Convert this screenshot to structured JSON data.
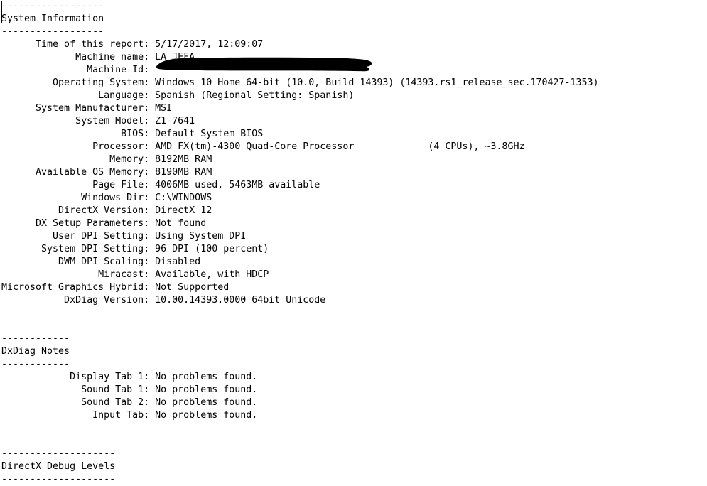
{
  "document": {
    "type": "dxdiag-report",
    "text_color": "#000000",
    "background_color": "#ffffff",
    "caret_visible": true
  },
  "sections": [
    {
      "id": "system-information",
      "rule_top": "------------------",
      "title": "System Information",
      "rule_bottom": "------------------",
      "entries": [
        {
          "label": "Time of this report",
          "value": "5/17/2017, 12:09:07"
        },
        {
          "label": "Machine name",
          "value": "LA_JEFA"
        },
        {
          "label": "Machine Id",
          "value": "",
          "redacted": true
        },
        {
          "label": "Operating System",
          "value": "Windows 10 Home 64-bit (10.0, Build 14393) (14393.rs1_release_sec.170427-1353)"
        },
        {
          "label": "Language",
          "value": "Spanish (Regional Setting: Spanish)"
        },
        {
          "label": "System Manufacturer",
          "value": "MSI"
        },
        {
          "label": "System Model",
          "value": "Z1-7641"
        },
        {
          "label": "BIOS",
          "value": "Default System BIOS"
        },
        {
          "label": "Processor",
          "value": "AMD FX(tm)-4300 Quad-Core Processor             (4 CPUs), ~3.8GHz"
        },
        {
          "label": "Memory",
          "value": "8192MB RAM"
        },
        {
          "label": "Available OS Memory",
          "value": "8190MB RAM"
        },
        {
          "label": "Page File",
          "value": "4006MB used, 5463MB available"
        },
        {
          "label": "Windows Dir",
          "value": "C:\\WINDOWS"
        },
        {
          "label": "DirectX Version",
          "value": "DirectX 12"
        },
        {
          "label": "DX Setup Parameters",
          "value": "Not found"
        },
        {
          "label": "User DPI Setting",
          "value": "Using System DPI"
        },
        {
          "label": "System DPI Setting",
          "value": "96 DPI (100 percent)"
        },
        {
          "label": "DWM DPI Scaling",
          "value": "Disabled"
        },
        {
          "label": "Miracast",
          "value": "Available, with HDCP"
        },
        {
          "label": "Microsoft Graphics Hybrid",
          "value": "Not Supported"
        },
        {
          "label": "DxDiag Version",
          "value": "10.00.14393.0000 64bit Unicode"
        }
      ]
    },
    {
      "id": "dxdiag-notes",
      "rule_top": "------------",
      "title": "DxDiag Notes",
      "rule_bottom": "------------",
      "entries": [
        {
          "label": "Display Tab 1",
          "value": "No problems found."
        },
        {
          "label": "Sound Tab 1",
          "value": "No problems found."
        },
        {
          "label": "Sound Tab 2",
          "value": "No problems found."
        },
        {
          "label": "Input Tab",
          "value": "No problems found."
        }
      ]
    },
    {
      "id": "directx-debug-levels",
      "rule_top": "--------------------",
      "title": "DirectX Debug Levels",
      "rule_bottom": "--------------------",
      "entries": []
    }
  ]
}
